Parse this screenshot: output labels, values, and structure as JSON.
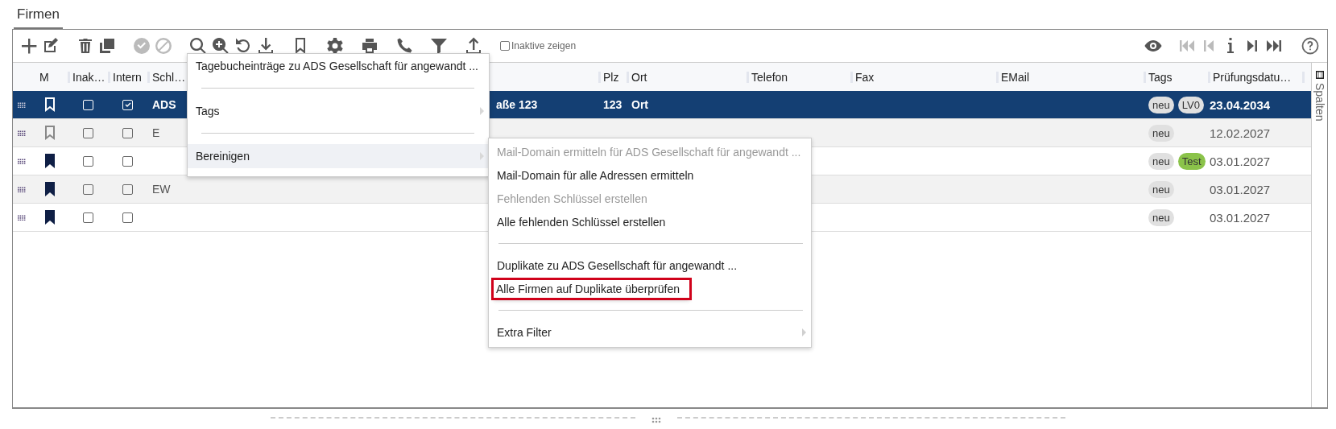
{
  "page_tab": {
    "label": "Firmen",
    "selected": true
  },
  "toolbar": {
    "left": [
      {
        "kind": "plus",
        "disabled": false
      },
      {
        "kind": "edit",
        "disabled": false
      },
      {
        "kind": "trash",
        "disabled": false
      },
      {
        "kind": "copy",
        "disabled": false
      },
      {
        "kind": "check",
        "disabled": true
      },
      {
        "kind": "ban",
        "disabled": true
      },
      {
        "kind": "search",
        "disabled": false
      },
      {
        "kind": "zoom",
        "disabled": false
      },
      {
        "kind": "undo",
        "disabled": false
      },
      {
        "kind": "download",
        "disabled": false
      },
      {
        "kind": "bookmark",
        "disabled": false
      },
      {
        "kind": "gear",
        "disabled": false
      },
      {
        "kind": "printer",
        "disabled": false
      },
      {
        "kind": "phone",
        "disabled": false
      },
      {
        "kind": "filter",
        "disabled": false
      },
      {
        "kind": "upload",
        "disabled": false
      }
    ],
    "show_inactive": {
      "label": "Inaktive zeigen",
      "checked": false
    },
    "right": [
      {
        "kind": "eye",
        "disabled": false
      },
      {
        "kind": "first",
        "disabled": true
      },
      {
        "kind": "prev",
        "disabled": true
      },
      {
        "kind": "info",
        "disabled": false
      },
      {
        "kind": "next",
        "disabled": false
      },
      {
        "kind": "last",
        "disabled": false
      },
      {
        "kind": "help",
        "disabled": false
      }
    ]
  },
  "table": {
    "columns": [
      "M",
      "Inak…",
      "Intern",
      "Schl…",
      "Plz",
      "Ort",
      "Telefon",
      "Fax",
      "EMail",
      "Tags",
      "Prüfungsdatu…"
    ],
    "rows": [
      {
        "selected": true,
        "marked": false,
        "inactive": false,
        "intern": true,
        "key": "ADS",
        "street": "aße 123",
        "plz": "123",
        "ort": "Ort",
        "tags": [
          {
            "label": "neu",
            "color": "#e0e0e0"
          },
          {
            "label": "LV0",
            "color": "#e0e0e0"
          }
        ],
        "date": "23.04.2034"
      },
      {
        "selected": false,
        "marked": false,
        "inactive": false,
        "intern": false,
        "key": "E",
        "street": "",
        "plz": "",
        "ort": "",
        "tags": [
          {
            "label": "neu",
            "color": "#e0e0e0"
          }
        ],
        "date": "12.02.2027"
      },
      {
        "selected": false,
        "marked": true,
        "inactive": false,
        "intern": false,
        "key": "",
        "street": "",
        "plz": "",
        "ort": "",
        "tags": [
          {
            "label": "neu",
            "color": "#e0e0e0"
          },
          {
            "label": "Test",
            "color": "#8bc34a"
          }
        ],
        "date": "03.01.2027"
      },
      {
        "selected": false,
        "marked": true,
        "inactive": false,
        "intern": false,
        "key": "EW",
        "street": "",
        "plz": "",
        "ort": "",
        "tags": [
          {
            "label": "neu",
            "color": "#e0e0e0"
          }
        ],
        "date": "03.01.2027"
      },
      {
        "selected": false,
        "marked": true,
        "inactive": false,
        "intern": false,
        "key": "",
        "street": "",
        "plz": "",
        "ort": "",
        "tags": [
          {
            "label": "neu",
            "color": "#e0e0e0"
          }
        ],
        "date": "03.01.2027"
      }
    ]
  },
  "columns_panel": {
    "label": "Spalten"
  },
  "context_menu": [
    {
      "kind": "item",
      "label": "Tagebucheinträge zu ADS Gesellschaft für angewandt ...",
      "submenu": false,
      "hovered": false
    },
    {
      "kind": "separator"
    },
    {
      "kind": "item",
      "label": "Tags",
      "submenu": true,
      "hovered": false
    },
    {
      "kind": "separator"
    },
    {
      "kind": "item",
      "label": "Bereinigen",
      "submenu": true,
      "hovered": true
    }
  ],
  "submenu": [
    {
      "kind": "item",
      "label": "Mail-Domain ermitteln für ADS Gesellschaft für angewandt ...",
      "disabled": true,
      "highlighted": false,
      "submenu": false
    },
    {
      "kind": "item",
      "label": "Mail-Domain für alle Adressen ermitteln",
      "disabled": false,
      "highlighted": false,
      "submenu": false
    },
    {
      "kind": "item",
      "label": "Fehlenden Schlüssel erstellen",
      "disabled": true,
      "highlighted": false,
      "submenu": false
    },
    {
      "kind": "item",
      "label": "Alle fehlenden Schlüssel erstellen",
      "disabled": false,
      "highlighted": false,
      "submenu": false
    },
    {
      "kind": "separator"
    },
    {
      "kind": "item",
      "label": "Duplikate zu ADS Gesellschaft für angewandt ...",
      "disabled": false,
      "highlighted": false,
      "submenu": false
    },
    {
      "kind": "item",
      "label": "Alle Firmen auf Duplikate überprüfen",
      "disabled": false,
      "highlighted": true,
      "submenu": false
    },
    {
      "kind": "separator"
    },
    {
      "kind": "item",
      "label": "Extra Filter",
      "disabled": false,
      "highlighted": false,
      "submenu": true
    }
  ]
}
